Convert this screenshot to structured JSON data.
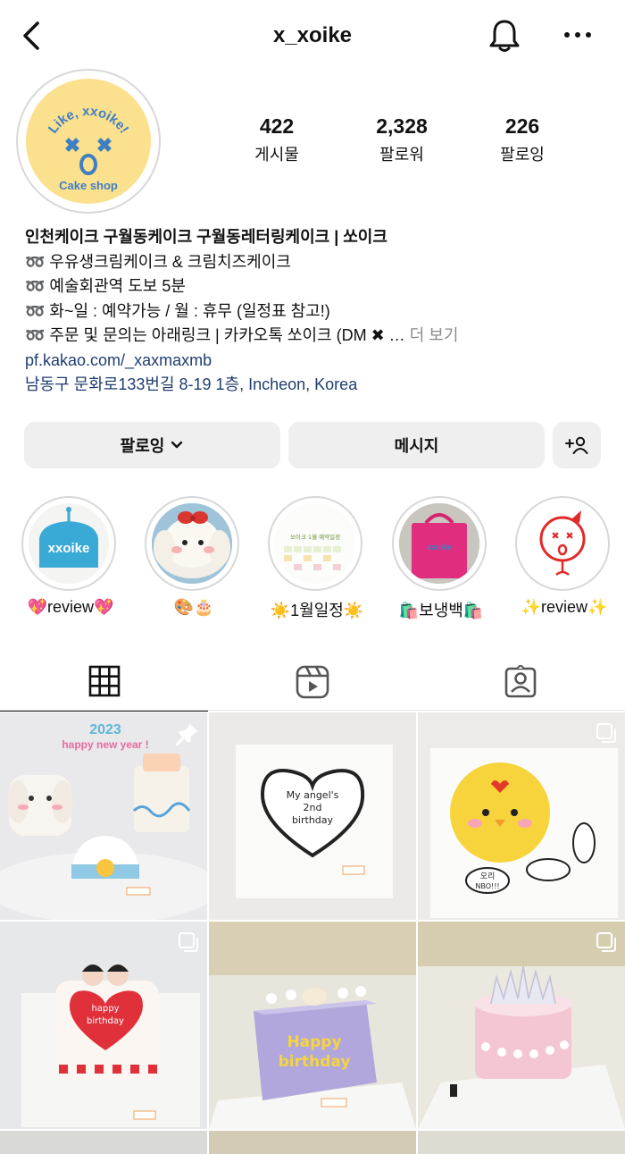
{
  "header": {
    "username": "x_xoike"
  },
  "profile": {
    "avatar_text_top": "Like, xxoike!",
    "avatar_text_bottom": "Cake shop",
    "stats": [
      {
        "count": "422",
        "label": "게시물"
      },
      {
        "count": "2,328",
        "label": "팔로워"
      },
      {
        "count": "226",
        "label": "팔로잉"
      }
    ]
  },
  "bio": {
    "name": "인천케이크 구월동케이크 구월동레터링케이크 | 쏘이크",
    "lines": [
      "➿ 우유생크림케이크 & 크림치즈케이크",
      "➿ 예술회관역 도보 5분",
      "➿ 화~일 : 예약가능 / 월 : 휴무 (일정표 참고!)",
      "➿ 주문 및 문의는 아래링크 | 카카오톡 쏘이크 (DM  ✖ …"
    ],
    "more_label": "더 보기",
    "link": "pf.kakao.com/_xaxmaxmb",
    "address": "남동구 문화로133번길 8-19 1층, Incheon, Korea"
  },
  "actions": {
    "following_label": "팔로잉",
    "message_label": "메시지"
  },
  "highlights": [
    {
      "caption": "💖review💖",
      "art_text": "xxoike"
    },
    {
      "caption": "🎨🎂",
      "art_text": ""
    },
    {
      "caption": "☀️1월일정☀️",
      "art_text": "쏘이크 1월 예약일정"
    },
    {
      "caption": "🛍️보냉백🛍️",
      "art_text": "xxoike"
    },
    {
      "caption": "✨review✨",
      "art_text": ""
    }
  ],
  "posts": [
    {
      "caption_lines": [
        "2023",
        "happy new year !"
      ],
      "pinned": true
    },
    {
      "caption_lines": [
        "My angel's",
        "2nd",
        "birthday"
      ],
      "pinned": false
    },
    {
      "caption_lines": [
        "오리",
        "NBO!!!"
      ],
      "pinned": false
    },
    {
      "caption_lines": [
        "happy",
        "birthday"
      ],
      "pinned": false
    },
    {
      "caption_lines": [
        "Happy",
        "birthday"
      ],
      "pinned": false
    },
    {
      "caption_lines": [],
      "pinned": false
    }
  ],
  "colors": {
    "avatar_bg": "#fbe08e",
    "avatar_blue": "#3f7fc3",
    "link": "#1f3e6f",
    "button_bg": "#efefef"
  },
  "icons": [
    "back-icon",
    "bell-icon",
    "more-icon",
    "chevron-down-icon",
    "add-person-icon",
    "grid-icon",
    "reels-icon",
    "tagged-icon",
    "pin-icon",
    "multi-image-icon"
  ]
}
